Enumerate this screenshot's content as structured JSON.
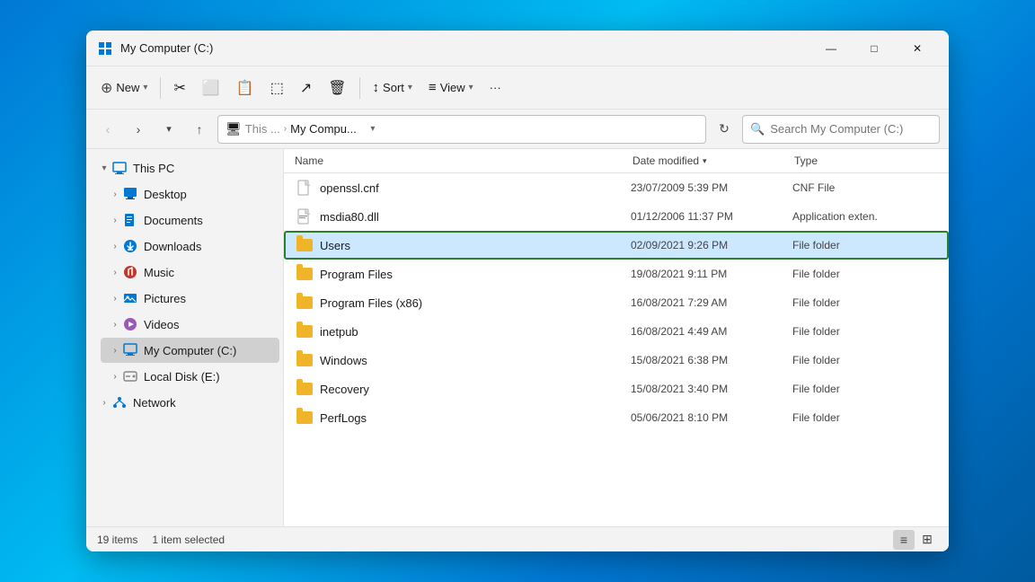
{
  "window": {
    "title": "My Computer (C:)",
    "controls": {
      "minimize": "—",
      "maximize": "□",
      "close": "✕"
    }
  },
  "toolbar": {
    "new_label": "New",
    "sort_label": "Sort",
    "view_label": "View",
    "more_label": "···"
  },
  "address_bar": {
    "path_parts": [
      "This ...",
      "My Compu..."
    ],
    "search_placeholder": "Search My Computer (C:)"
  },
  "sidebar": {
    "items": [
      {
        "id": "this-pc",
        "label": "This PC",
        "expanded": true,
        "indent": 0,
        "icon": "pc"
      },
      {
        "id": "desktop",
        "label": "Desktop",
        "expanded": false,
        "indent": 1,
        "icon": "desktop"
      },
      {
        "id": "documents",
        "label": "Documents",
        "expanded": false,
        "indent": 1,
        "icon": "docs"
      },
      {
        "id": "downloads",
        "label": "Downloads",
        "expanded": false,
        "indent": 1,
        "icon": "downloads"
      },
      {
        "id": "music",
        "label": "Music",
        "expanded": false,
        "indent": 1,
        "icon": "music"
      },
      {
        "id": "pictures",
        "label": "Pictures",
        "expanded": false,
        "indent": 1,
        "icon": "pictures"
      },
      {
        "id": "videos",
        "label": "Videos",
        "expanded": false,
        "indent": 1,
        "icon": "videos"
      },
      {
        "id": "my-computer",
        "label": "My Computer (C:)",
        "expanded": false,
        "indent": 1,
        "icon": "computer",
        "selected": true
      },
      {
        "id": "local-disk",
        "label": "Local Disk (E:)",
        "expanded": false,
        "indent": 1,
        "icon": "disk"
      },
      {
        "id": "network",
        "label": "Network",
        "expanded": false,
        "indent": 0,
        "icon": "network"
      }
    ]
  },
  "file_list": {
    "columns": [
      "Name",
      "Date modified",
      "Type"
    ],
    "files": [
      {
        "name": "openssl.cnf",
        "date": "23/07/2009 5:39 PM",
        "type": "CNF File",
        "icon": "file",
        "selected": false
      },
      {
        "name": "msdia80.dll",
        "date": "01/12/2006 11:37 PM",
        "type": "Application exten.",
        "icon": "dll",
        "selected": false
      },
      {
        "name": "Users",
        "date": "02/09/2021 9:26 PM",
        "type": "File folder",
        "icon": "folder",
        "selected": true
      },
      {
        "name": "Program Files",
        "date": "19/08/2021 9:11 PM",
        "type": "File folder",
        "icon": "folder",
        "selected": false
      },
      {
        "name": "Program Files (x86)",
        "date": "16/08/2021 7:29 AM",
        "type": "File folder",
        "icon": "folder",
        "selected": false
      },
      {
        "name": "inetpub",
        "date": "16/08/2021 4:49 AM",
        "type": "File folder",
        "icon": "folder",
        "selected": false
      },
      {
        "name": "Windows",
        "date": "15/08/2021 6:38 PM",
        "type": "File folder",
        "icon": "folder",
        "selected": false
      },
      {
        "name": "Recovery",
        "date": "15/08/2021 3:40 PM",
        "type": "File folder",
        "icon": "folder",
        "selected": false
      },
      {
        "name": "PerfLogs",
        "date": "05/06/2021 8:10 PM",
        "type": "File folder",
        "icon": "folder",
        "selected": false
      }
    ]
  },
  "status_bar": {
    "item_count": "19 items",
    "selected_count": "1 item selected"
  }
}
